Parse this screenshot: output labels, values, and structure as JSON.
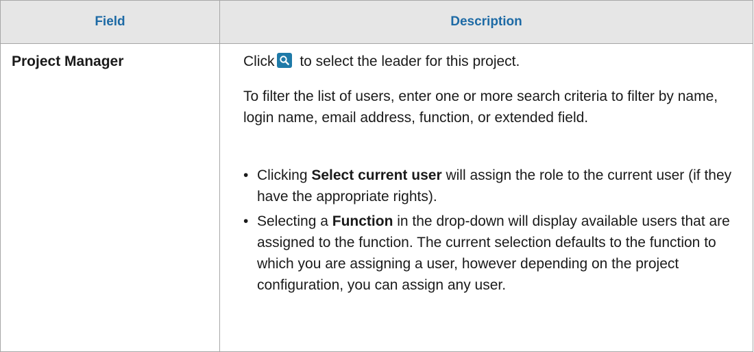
{
  "table": {
    "headers": {
      "field": "Field",
      "description": "Description"
    },
    "row": {
      "field": "Project Manager",
      "click_before": "Click",
      "click_after": " to select the leader for this project.",
      "filter_text": "To filter the list of users, enter one or more search criteria to filter by name, login name, email address, function, or extended field.",
      "bullets": [
        {
          "marker": "•",
          "before": "Clicking ",
          "bold": "Select current user",
          "after": " will assign the role to the current user (if they have the appropriate rights)."
        },
        {
          "marker": "•",
          "before": "Selecting a ",
          "bold": "Function",
          "after": " in the drop-down will display available users that are assigned to the function. The current selection defaults to the function to which you are assigning a user, however depending on the project configuration, you can assign any user."
        }
      ]
    }
  },
  "icons": {
    "search_button": "search-icon"
  },
  "colors": {
    "header_text": "#1d6aa5",
    "header_bg": "#e6e6e6",
    "border": "#a6a6a6",
    "icon_bg": "#1e7aa8"
  }
}
